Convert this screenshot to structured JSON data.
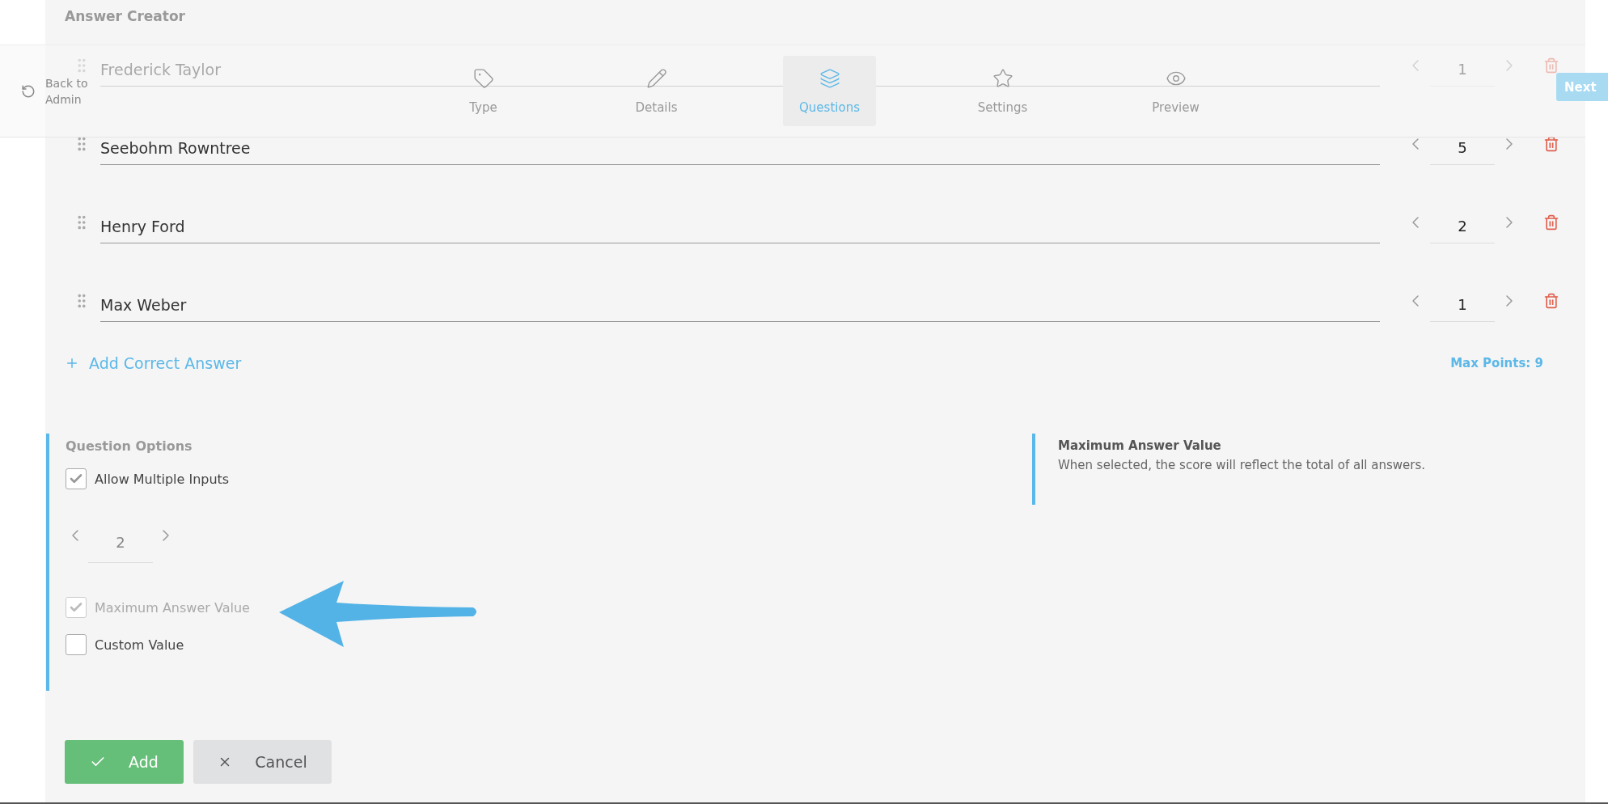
{
  "panel": {
    "title": "Answer Creator"
  },
  "nav": {
    "back": {
      "label": "Back to Admin"
    },
    "tabs": [
      {
        "label": "Type",
        "selected": false
      },
      {
        "label": "Details",
        "selected": false
      },
      {
        "label": "Questions",
        "selected": true
      },
      {
        "label": "Settings",
        "selected": false
      },
      {
        "label": "Preview",
        "selected": false
      }
    ],
    "next": {
      "label": "Next"
    }
  },
  "answers": [
    {
      "text": "Frederick Taylor",
      "points": "1"
    },
    {
      "text": "Seebohm Rowntree",
      "points": "5"
    },
    {
      "text": "Henry Ford",
      "points": "2"
    },
    {
      "text": "Max Weber",
      "points": "1"
    }
  ],
  "add_answer": {
    "label": "Add Correct Answer"
  },
  "max_points": "Max Points: 9",
  "options": {
    "title": "Question Options",
    "items": [
      {
        "kind": "checkbox",
        "label": "Allow Multiple Inputs",
        "checked": true,
        "disabled": false
      },
      {
        "kind": "stepper",
        "value": "2"
      },
      {
        "kind": "checkbox",
        "label": "Maximum Answer Value",
        "checked": true,
        "disabled": true
      },
      {
        "kind": "checkbox",
        "label": "Custom Value",
        "checked": false,
        "disabled": false
      }
    ]
  },
  "info": {
    "title": "Maximum Answer Value",
    "text": "When selected, the score will reflect the total of all answers."
  },
  "buttons": [
    {
      "kind": "confirm",
      "label": "Add"
    },
    {
      "kind": "cancel",
      "label": "Cancel"
    }
  ]
}
